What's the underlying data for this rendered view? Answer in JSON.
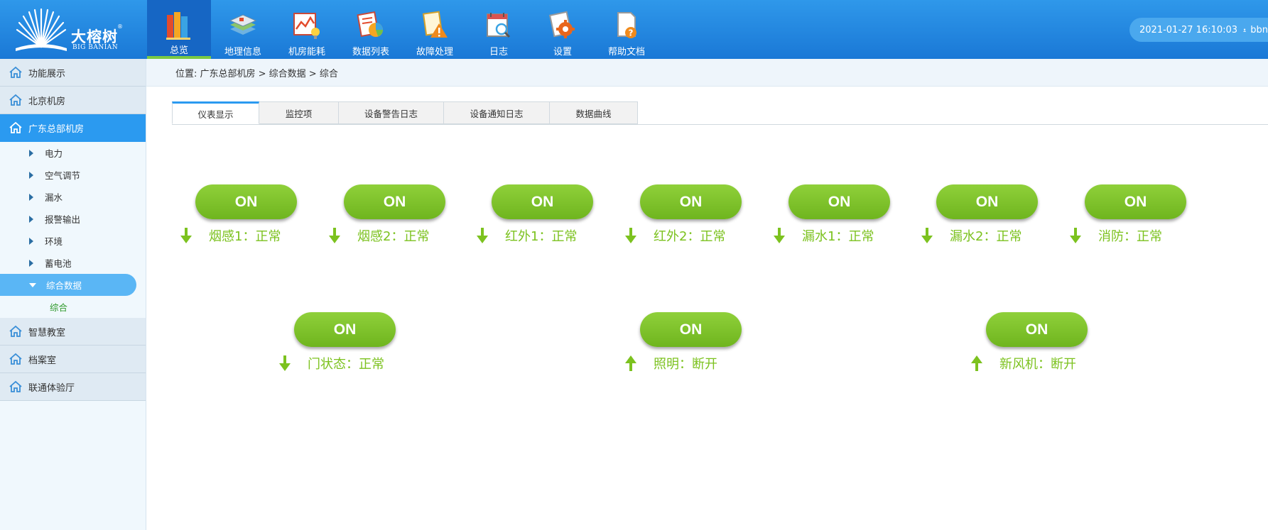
{
  "app": {
    "logo_cn": "大榕树",
    "logo_en": "BIG BANIAN",
    "logo_reg": "®"
  },
  "nav": {
    "items": [
      {
        "label": "总览",
        "icon": "books-icon"
      },
      {
        "label": "地理信息",
        "icon": "map-icon"
      },
      {
        "label": "机房能耗",
        "icon": "energy-chart-icon"
      },
      {
        "label": "数据列表",
        "icon": "data-list-icon"
      },
      {
        "label": "故障处理",
        "icon": "warning-icon"
      },
      {
        "label": "日志",
        "icon": "calendar-icon"
      },
      {
        "label": "设置",
        "icon": "gear-icon"
      },
      {
        "label": "帮助文档",
        "icon": "help-document-icon"
      }
    ],
    "active_index": 0
  },
  "user": {
    "datetime": "2021-01-27  16:10:03",
    "name": "bbn"
  },
  "sidebar": {
    "items": [
      {
        "label": "功能展示"
      },
      {
        "label": "北京机房"
      },
      {
        "label": "广东总部机房"
      },
      {
        "label": "智慧教室"
      },
      {
        "label": "档案室"
      },
      {
        "label": "联通体验厅"
      }
    ],
    "subitems": [
      {
        "label": "电力"
      },
      {
        "label": "空气调节"
      },
      {
        "label": "漏水"
      },
      {
        "label": "报警输出"
      },
      {
        "label": "环境"
      },
      {
        "label": "蓄电池"
      },
      {
        "label": "综合数据"
      }
    ],
    "leaf": "综合"
  },
  "breadcrumb": "位置:  广东总部机房 > 综合数据 > 综合",
  "tabs": [
    {
      "label": "仪表显示"
    },
    {
      "label": "监控项"
    },
    {
      "label": "设备警告日志"
    },
    {
      "label": "设备通知日志"
    },
    {
      "label": "数据曲线"
    }
  ],
  "indicators_row1": [
    {
      "button": "ON",
      "label": "烟感1：正常",
      "arrow": "down"
    },
    {
      "button": "ON",
      "label": "烟感2：正常",
      "arrow": "down"
    },
    {
      "button": "ON",
      "label": "红外1：正常",
      "arrow": "down"
    },
    {
      "button": "ON",
      "label": "红外2：正常",
      "arrow": "down"
    },
    {
      "button": "ON",
      "label": "漏水1：正常",
      "arrow": "down"
    },
    {
      "button": "ON",
      "label": "漏水2：正常",
      "arrow": "down"
    },
    {
      "button": "ON",
      "label": "消防：正常",
      "arrow": "down"
    }
  ],
  "indicators_row2": [
    {
      "button": "ON",
      "label": "门状态：正常",
      "arrow": "down"
    },
    {
      "button": "ON",
      "label": "照明：断开",
      "arrow": "up"
    },
    {
      "button": "ON",
      "label": "新风机：断开",
      "arrow": "up"
    }
  ],
  "colors": {
    "topbar": "#1f86df",
    "sidebar_active": "#2b9af0",
    "status_green": "#7cc21f",
    "button_green": "#7cc21f"
  }
}
